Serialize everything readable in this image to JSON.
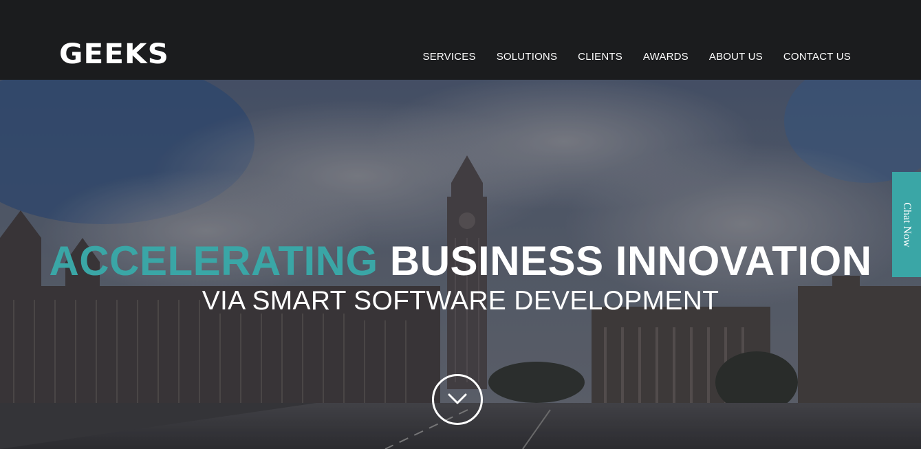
{
  "header": {
    "logo_text": "GEEKS",
    "nav": [
      {
        "label": "SERVICES"
      },
      {
        "label": "SOLUTIONS"
      },
      {
        "label": "CLIENTS"
      },
      {
        "label": "AWARDS"
      },
      {
        "label": "ABOUT US"
      },
      {
        "label": "CONTACT US"
      }
    ]
  },
  "hero": {
    "headline_accent": "ACCELERATING",
    "headline_main": "BUSINESS INNOVATION",
    "subheadline": "VIA SMART SOFTWARE DEVELOPMENT",
    "scroll_icon": "chevron-down-icon"
  },
  "chat": {
    "label": "Chat Now"
  },
  "colors": {
    "accent": "#3aa6a6",
    "header_bg": "#1b1c1e",
    "text": "#ffffff"
  }
}
